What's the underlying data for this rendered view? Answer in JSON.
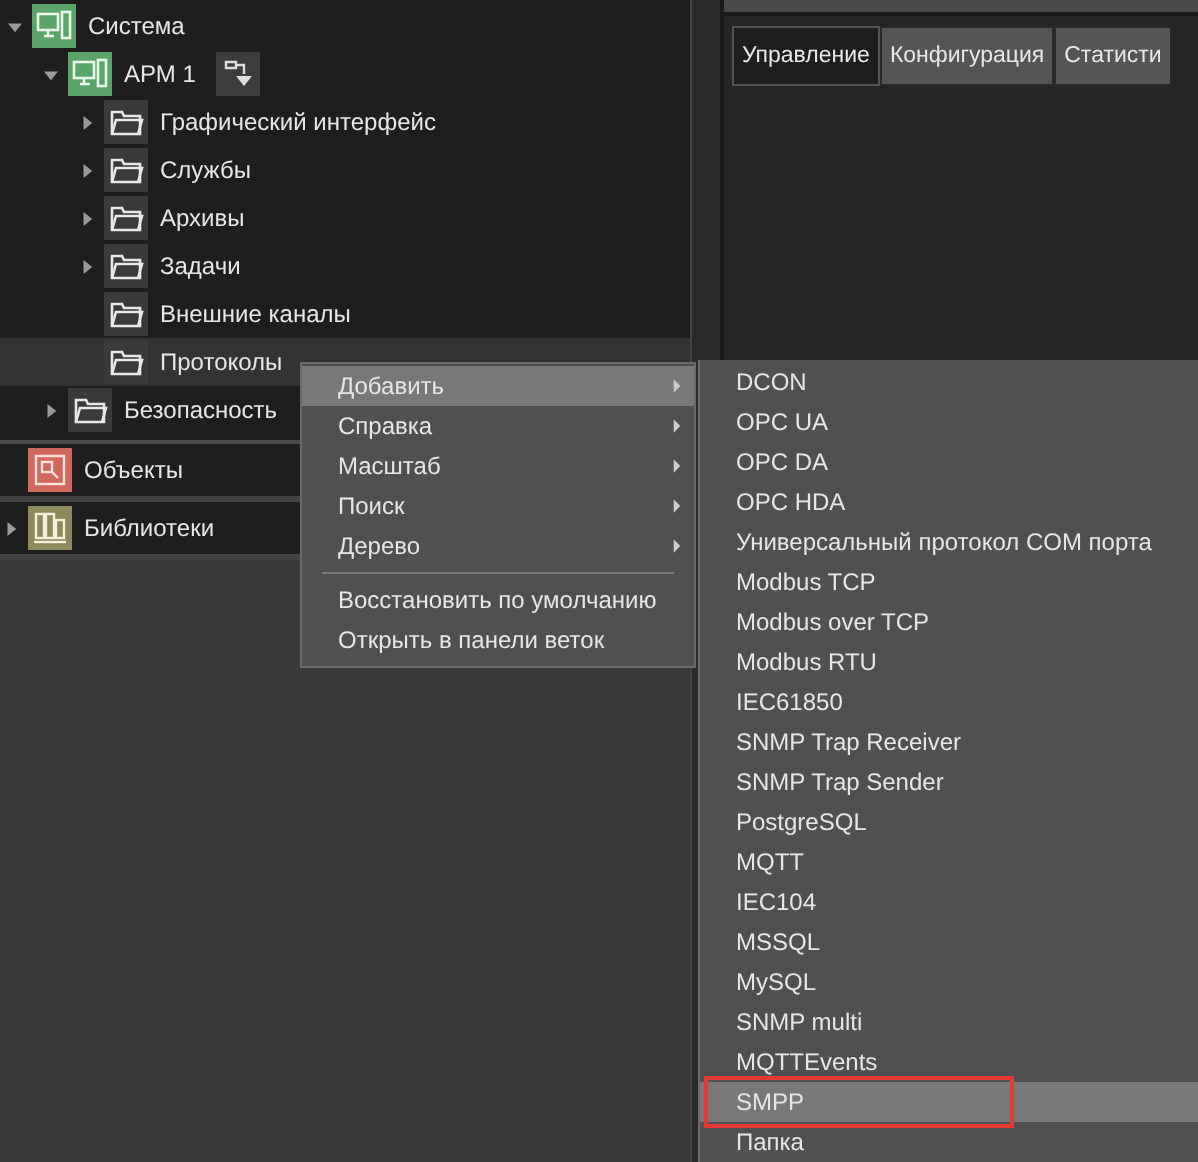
{
  "tree": [
    {
      "label": "Система",
      "kind": "computer-group",
      "expanded": true,
      "selected": false,
      "children": [
        {
          "label": "АРМ 1",
          "kind": "computer",
          "expanded": true,
          "selected": false,
          "action_button": true,
          "children": [
            {
              "label": "Графический интерфейс",
              "kind": "folder",
              "expanded": false,
              "selected": false
            },
            {
              "label": "Службы",
              "kind": "folder",
              "expanded": false,
              "selected": false
            },
            {
              "label": "Архивы",
              "kind": "folder",
              "expanded": false,
              "selected": false
            },
            {
              "label": "Задачи",
              "kind": "folder",
              "expanded": false,
              "selected": false
            },
            {
              "label": "Внешние каналы",
              "kind": "folder",
              "selected": false
            },
            {
              "label": "Протоколы",
              "kind": "folder",
              "selected": true
            }
          ]
        },
        {
          "label": "Безопасность",
          "kind": "folder",
          "expanded": false,
          "selected": false
        }
      ]
    }
  ],
  "sections": [
    {
      "label": "Объекты",
      "kind": "objects"
    },
    {
      "label": "Библиотеки",
      "kind": "libraries",
      "expanded": false
    }
  ],
  "tabs": [
    {
      "label": "Управление",
      "selected": true
    },
    {
      "label": "Конфигурация",
      "selected": false
    },
    {
      "label": "Статисти",
      "selected": false
    }
  ],
  "context_menu": [
    {
      "label": "Добавить",
      "kind": "submenu",
      "selected": true
    },
    {
      "label": "Справка",
      "kind": "submenu",
      "selected": false
    },
    {
      "label": "Масштаб",
      "kind": "submenu",
      "selected": false
    },
    {
      "label": "Поиск",
      "kind": "submenu",
      "selected": false
    },
    {
      "label": "Дерево",
      "kind": "submenu",
      "selected": false
    },
    {
      "kind": "separator"
    },
    {
      "label": "Восстановить по умолчанию",
      "kind": "action",
      "selected": false
    },
    {
      "label": "Открыть в панели веток",
      "kind": "action",
      "selected": false
    }
  ],
  "submenu": [
    {
      "label": "DCON",
      "selected": false
    },
    {
      "label": "OPC UA",
      "selected": false
    },
    {
      "label": "OPC DA",
      "selected": false
    },
    {
      "label": "OPC HDA",
      "selected": false
    },
    {
      "label": "Универсальный протокол COM порта",
      "selected": false
    },
    {
      "label": "Modbus TCP",
      "selected": false
    },
    {
      "label": "Modbus over TCP",
      "selected": false
    },
    {
      "label": "Modbus RTU",
      "selected": false
    },
    {
      "label": "IEC61850",
      "selected": false
    },
    {
      "label": "SNMP Trap Receiver",
      "selected": false
    },
    {
      "label": "SNMP Trap Sender",
      "selected": false
    },
    {
      "label": "PostgreSQL",
      "selected": false
    },
    {
      "label": "MQTT",
      "selected": false
    },
    {
      "label": "IEC104",
      "selected": false
    },
    {
      "label": "MSSQL",
      "selected": false
    },
    {
      "label": "MySQL",
      "selected": false
    },
    {
      "label": "SNMP multi",
      "selected": false
    },
    {
      "label": "MQTTEvents",
      "selected": false
    },
    {
      "label": "SMPP",
      "selected": true,
      "outlined": true
    },
    {
      "label": "Папка",
      "selected": false
    }
  ]
}
